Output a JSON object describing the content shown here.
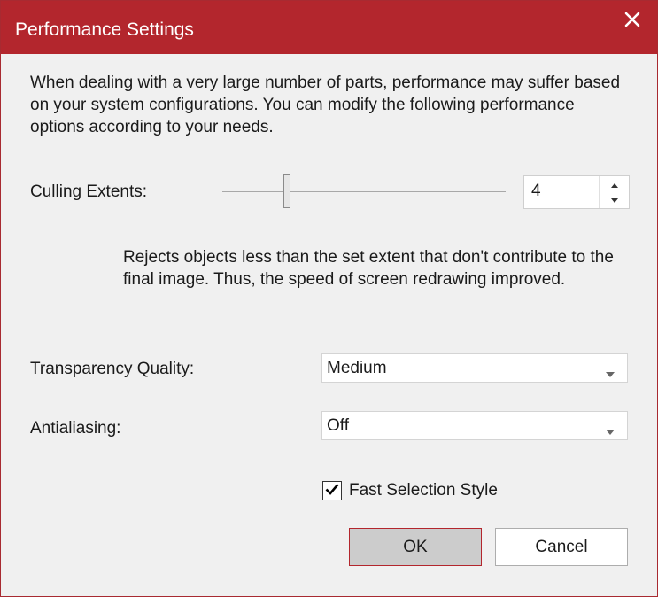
{
  "window": {
    "title": "Performance Settings",
    "accent_color": "#b3262d",
    "close_icon": "close-icon"
  },
  "intro": "When dealing with a very large number of parts, performance may suffer based on your system configurations. You can modify the following performance options according to your needs.",
  "culling": {
    "label": "Culling Extents:",
    "value": "4",
    "slider_fraction": 0.22,
    "description": "Rejects objects less than the set extent that don't contribute to the final image. Thus, the speed of screen redrawing improved."
  },
  "transparency": {
    "label": "Transparency Quality:",
    "selected": "Medium"
  },
  "antialiasing": {
    "label": "Antialiasing:",
    "selected": "Off"
  },
  "fast_selection": {
    "label": "Fast Selection Style",
    "checked": true
  },
  "buttons": {
    "ok": "OK",
    "cancel": "Cancel"
  }
}
